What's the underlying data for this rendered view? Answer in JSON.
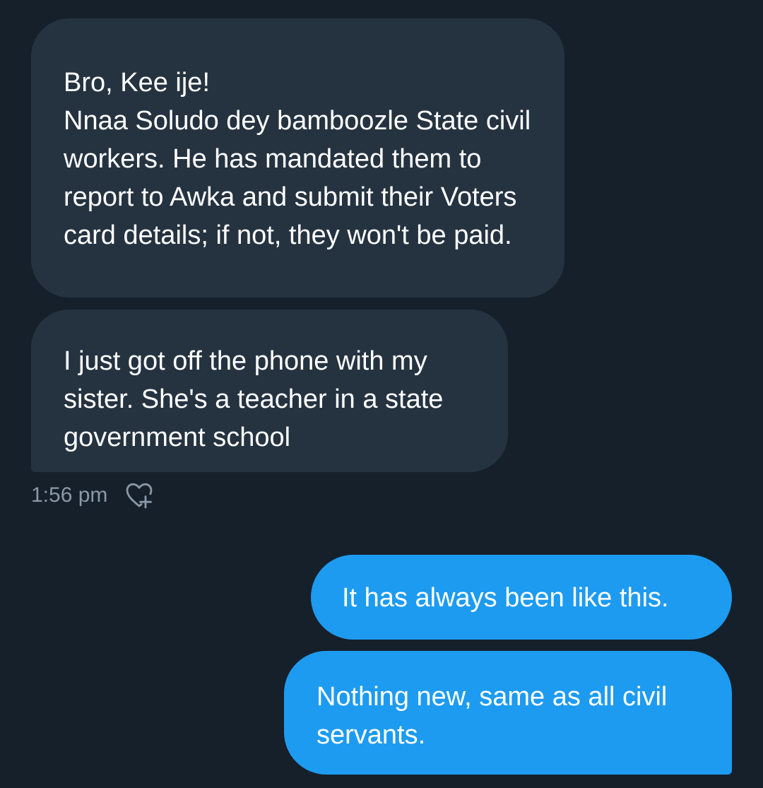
{
  "conversation": {
    "received": [
      {
        "text": "Bro, Kee ije!\nNnaa Soludo dey bamboozle State civil workers. He has mandated them to report to Awka and submit their Voters card details; if not, they won't be paid."
      },
      {
        "text": "I just got off the phone with my sister. She's a teacher in a state government school"
      }
    ],
    "received_meta": {
      "timestamp": "1:56 pm",
      "reaction_icon": "heart-plus-icon"
    },
    "sent": [
      {
        "text": "It has always been like this."
      },
      {
        "text": "Nothing new, same as all civil servants."
      }
    ]
  },
  "colors": {
    "background": "#15202b",
    "received_bubble": "#253341",
    "sent_bubble": "#1d9bf0",
    "timestamp": "#8b98a5"
  }
}
